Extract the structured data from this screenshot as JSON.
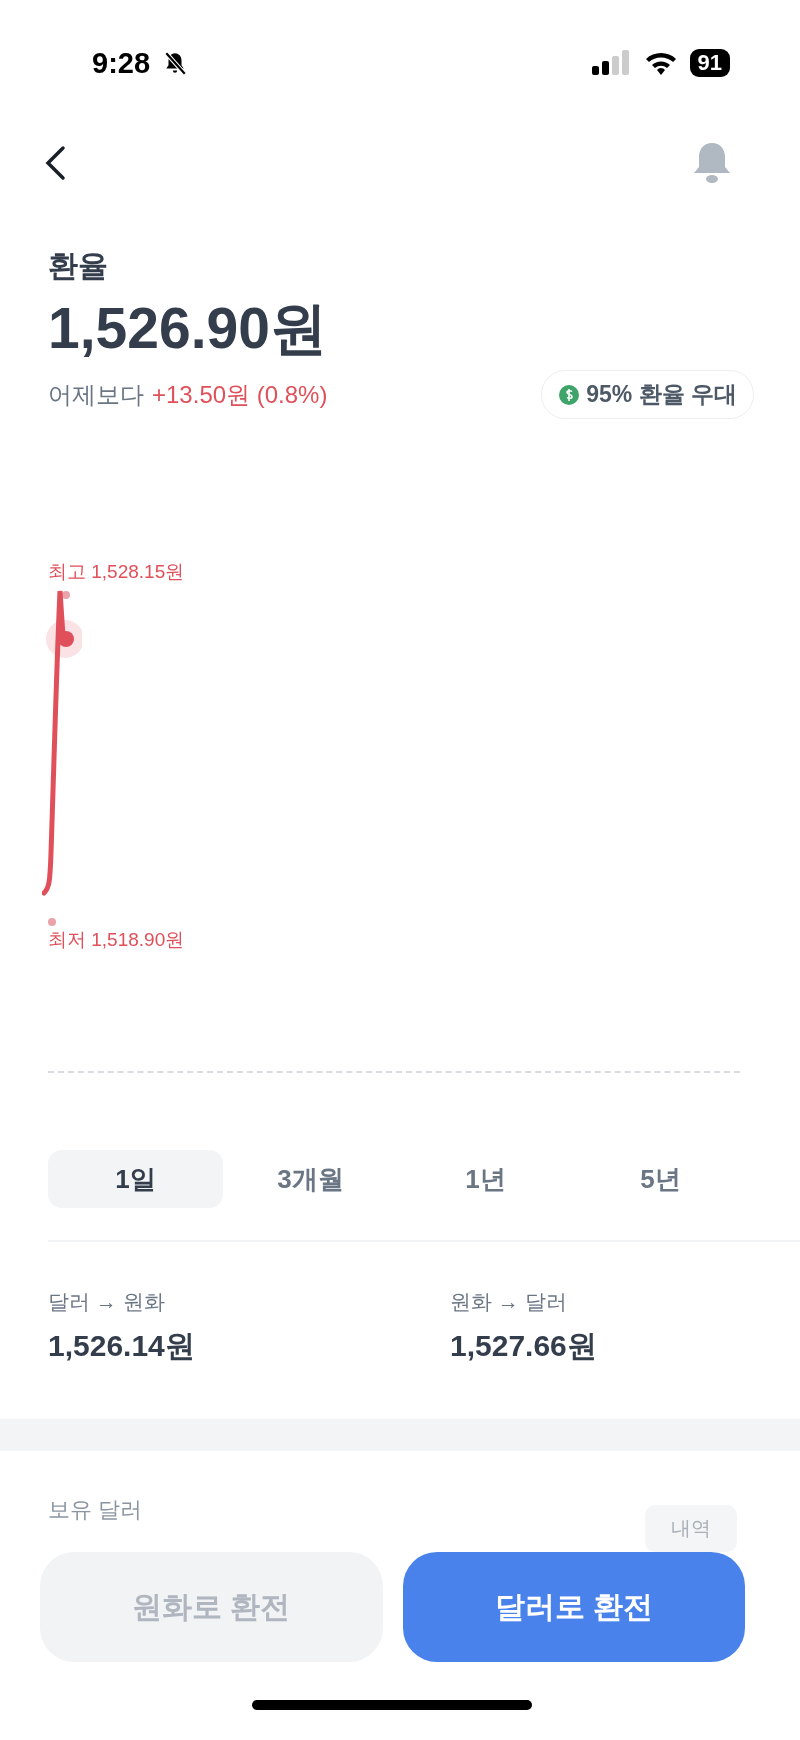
{
  "status_bar": {
    "time": "9:28",
    "battery": "91"
  },
  "header": {
    "title": "환율",
    "rate": "1,526.90원",
    "change_label": "어제보다",
    "change": "+13.50원 (0.8%)",
    "badge": "95% 환율 우대"
  },
  "chart": {
    "high_label": "최고 1,528.15원",
    "low_label": "최저 1,518.90원"
  },
  "periods": [
    {
      "label": "1일",
      "selected": true
    },
    {
      "label": "3개월",
      "selected": false
    },
    {
      "label": "1년",
      "selected": false
    },
    {
      "label": "5년",
      "selected": false
    }
  ],
  "rates": [
    {
      "label": "달러 → 원화",
      "value": "1,526.14원"
    },
    {
      "label": "원화 → 달러",
      "value": "1,527.66원"
    }
  ],
  "holdings": {
    "label": "보유 달러",
    "history_button": "내역"
  },
  "actions": [
    {
      "label": "원화로 환전",
      "kind": "secondary"
    },
    {
      "label": "달러로 환전",
      "kind": "primary"
    }
  ]
}
